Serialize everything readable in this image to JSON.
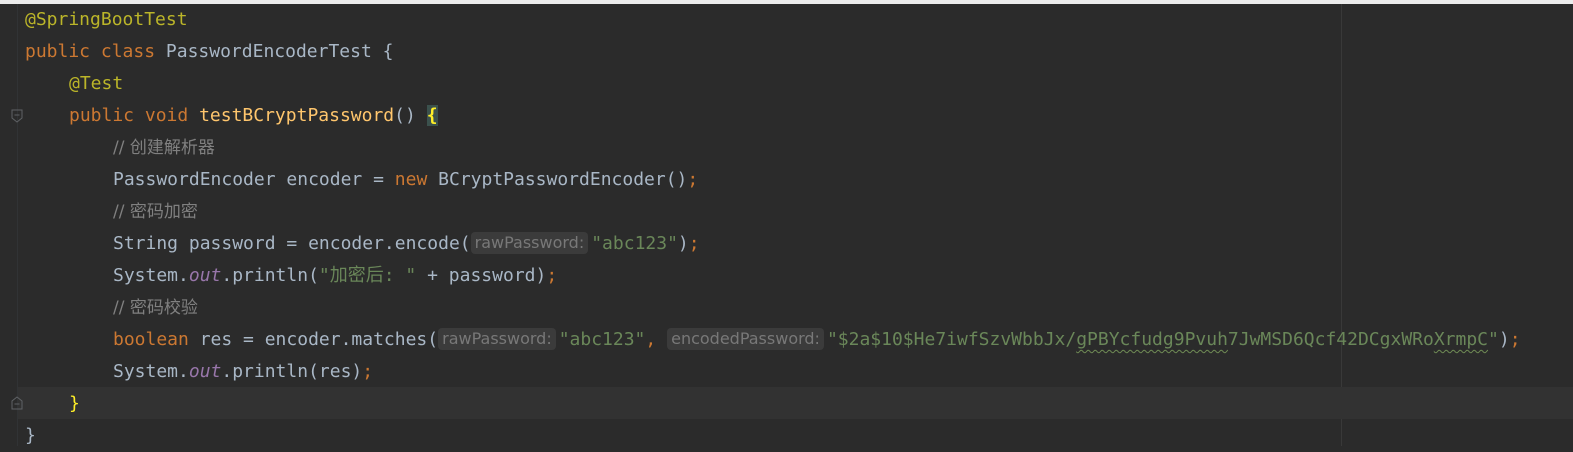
{
  "code": {
    "l1": {
      "annotation": "@SpringBootTest"
    },
    "l2": {
      "kw1": "public",
      "kw2": "class",
      "name": "PasswordEncoderTest",
      "brace": "{"
    },
    "l3": {
      "annotation": "@Test"
    },
    "l4": {
      "kw1": "public",
      "kw2": "void",
      "method": "testBCryptPassword",
      "parens": "()",
      "brace": "{"
    },
    "l5": {
      "comment": "// 创建解析器"
    },
    "l6": {
      "type": "PasswordEncoder",
      "rest": "encoder = ",
      "kw": "new",
      "ctor": "BCryptPasswordEncoder()",
      "semi": ";"
    },
    "l7": {
      "comment": "// 密码加密"
    },
    "l8": {
      "pre": "String password = encoder.encode(",
      "hint": "rawPassword:",
      "str": "\"abc123\"",
      "post": ")",
      "semi": ";"
    },
    "l9": {
      "pre": "System.",
      "field": "out",
      "mid": ".println(",
      "str": "\"加密后: \"",
      "post": " + password)",
      "semi": ";"
    },
    "l10": {
      "comment": "// 密码校验"
    },
    "l11": {
      "kw": "boolean",
      "pre": " res = encoder.matches(",
      "hint1": "rawPassword:",
      "str1": "\"abc123\"",
      "comma": ", ",
      "hint2": "encodedPassword:",
      "str2a": "\"$2a$10$He7iwfSzvWbbJx/",
      "str2b": "gPBYcfudg9Pvuh",
      "str2c": "7JwMSD6Qcf42DCgxWRo",
      "str2d": "XrmpC",
      "str2e": "\"",
      "post": ")",
      "semi": ";"
    },
    "l12": {
      "pre": "System.",
      "field": "out",
      "post": ".println(res)",
      "semi": ";"
    },
    "l13": {
      "brace": "}"
    },
    "l14": {
      "brace": "}"
    }
  }
}
